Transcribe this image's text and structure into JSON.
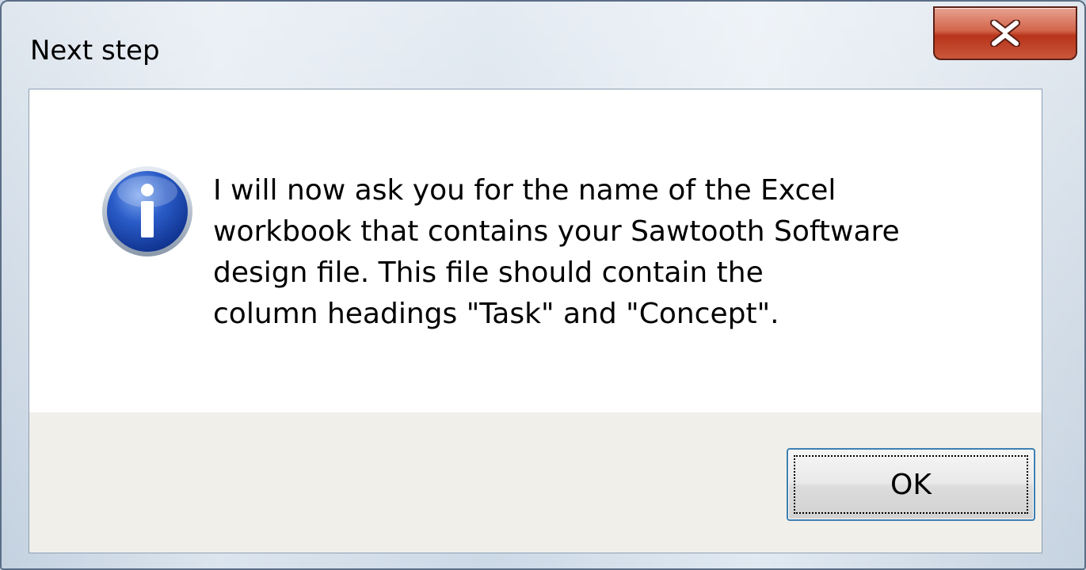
{
  "window": {
    "title": "Next step",
    "close_glyph": "close-x-icon"
  },
  "dialog": {
    "icon": "info-icon",
    "message_lines": [
      "I will now ask you for the name of the Excel",
      "workbook that contains your Sawtooth Software",
      "design file.  This file should contain the",
      "column headings \"Task\" and \"Concept\"."
    ],
    "ok_label": "OK"
  },
  "colors": {
    "close_button": "#c9573b",
    "info_icon": "#1f4fb8",
    "ok_focus_border": "#3c7fb1"
  }
}
